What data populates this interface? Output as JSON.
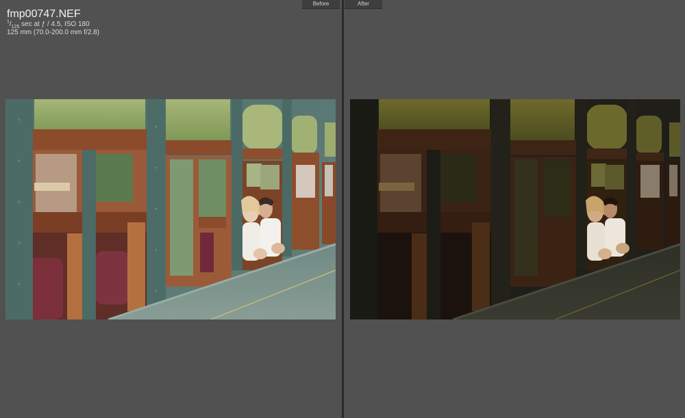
{
  "photo_info": {
    "filename": "fmp00747.NEF",
    "shutter_numerator": "1",
    "shutter_denominator": "125",
    "exposure_rest": " sec at ƒ / 4.5, ISO 180",
    "lens": "125 mm (70.0-200.0 mm f/2.8)"
  },
  "tabs": {
    "before_label": "Before",
    "after_label": "After"
  },
  "colors": {
    "background": "#515151",
    "divider": "#2a2a2a",
    "before_frame": "#4f6f6a",
    "after_frame": "#2c2a22"
  },
  "images": {
    "before": "photo-before-train-couple",
    "after": "photo-after-train-couple-graded"
  }
}
